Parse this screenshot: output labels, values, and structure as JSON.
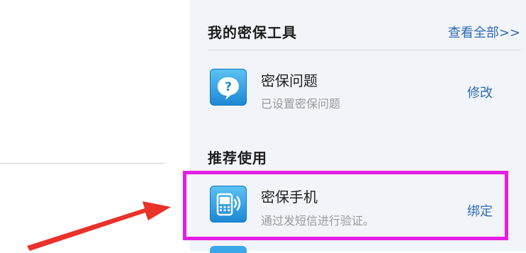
{
  "security_tools": {
    "title": "我的密保工具",
    "view_all_label": "查看全部>>",
    "items": [
      {
        "icon": "question-icon",
        "title": "密保问题",
        "subtitle": "已设置密保问题",
        "action_label": "修改"
      }
    ]
  },
  "recommended": {
    "title": "推荐使用",
    "items": [
      {
        "icon": "mobile-phone-icon",
        "title": "密保手机",
        "subtitle": "通过发短信进行验证。",
        "action_label": "绑定"
      }
    ]
  },
  "annotations": {
    "highlight_color": "#e51ee5",
    "arrow_color": "#e8322a"
  }
}
